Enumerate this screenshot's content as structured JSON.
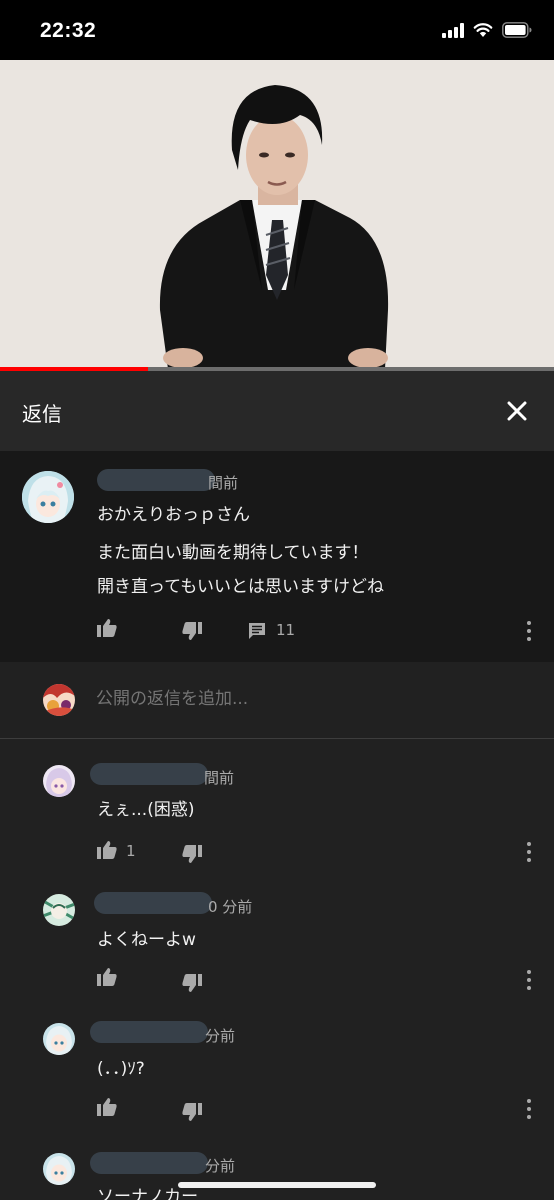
{
  "status_bar": {
    "time": "22:32"
  },
  "video": {
    "progress_fraction": 0.267
  },
  "replies_panel": {
    "title": "返信",
    "close_icon": "close-icon"
  },
  "parent_comment": {
    "time_ago": "間前",
    "lines": [
      "おかえりおっｐさん",
      "また面白い動画を期待しています！",
      "開き直ってもいいとは思いますけどね"
    ],
    "reply_count": "11"
  },
  "add_reply": {
    "placeholder": "公開の返信を追加..."
  },
  "replies": [
    {
      "time_ago": "間前",
      "text": "えぇ...(困惑)",
      "like_count": "1"
    },
    {
      "time_ago": "0 分前",
      "text": "よくねーよw",
      "like_count": ""
    },
    {
      "time_ago": "分前",
      "text": "(．．)ｿ?",
      "like_count": ""
    },
    {
      "time_ago": "分前",
      "text": "ソーナノカー",
      "like_count": ""
    }
  ],
  "colors": {
    "accent": "#ff0000",
    "background": "#212121",
    "header": "#282828",
    "highlight": "#181818"
  }
}
